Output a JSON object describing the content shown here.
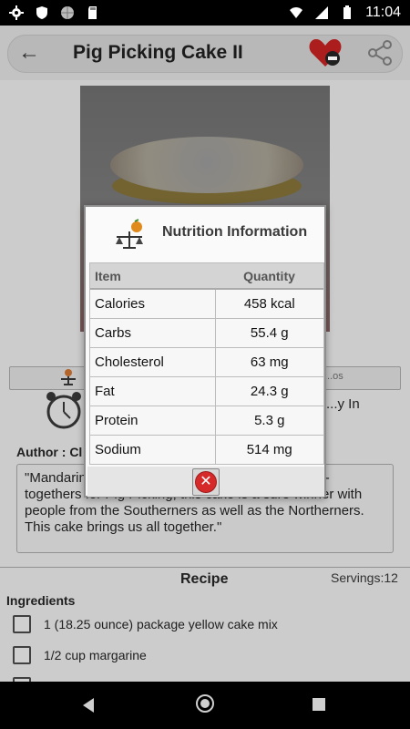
{
  "status_bar": {
    "time": "11:04",
    "icons": [
      "gear-icon",
      "shield-icon",
      "sphere-icon",
      "sd-card-icon",
      "wifi-icon",
      "signal-icon",
      "battery-icon"
    ]
  },
  "app_bar": {
    "title": "Pig Picking Cake II",
    "back_icon": "arrow-left-icon",
    "favorite_icon": "heart-minus-icon",
    "share_icon": "share-icon"
  },
  "recipe": {
    "image": "cake-photo",
    "tab_right_label": "...os",
    "ready_in_label": "...y In",
    "author_label": "Author : Cl",
    "description": "\"Mandarin ... ecans and coconut ... and all the get-togethers for Pig Picking, this cake is a sure winner with people from the Southerners as well as the Northerners. This cake brings us all together.\"",
    "section_title": "Recipe",
    "servings": "Servings:12",
    "ingredients_heading": "Ingredients",
    "ingredients": [
      "1 (18.25 ounce) package yellow cake mix",
      "1/2 cup margarine",
      ""
    ]
  },
  "dialog": {
    "title": "Nutrition Information",
    "logo_icon": "nutrition-scale-logo",
    "columns": [
      "Item",
      "Quantity"
    ],
    "rows": [
      {
        "item": "Calories",
        "quantity": "458 kcal"
      },
      {
        "item": "Carbs",
        "quantity": "55.4 g"
      },
      {
        "item": "Cholesterol",
        "quantity": "63 mg"
      },
      {
        "item": "Fat",
        "quantity": "24.3 g"
      },
      {
        "item": "Protein",
        "quantity": "5.3 g"
      },
      {
        "item": "Sodium",
        "quantity": "514 mg"
      }
    ],
    "close_icon": "close-x-icon",
    "close_symbol": "✕"
  },
  "nav_bar": {
    "back_icon": "triangle-back-icon",
    "home_icon": "circle-home-icon",
    "recent_icon": "square-recent-icon"
  }
}
